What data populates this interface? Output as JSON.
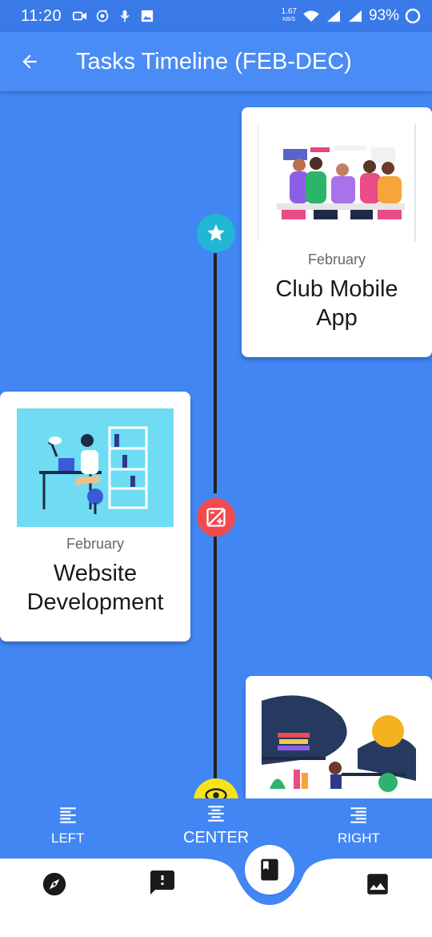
{
  "status_bar": {
    "time": "11:20",
    "net_speed_value": "1.67",
    "net_speed_unit": "KB/S",
    "battery": "93%",
    "icons": [
      "video-icon",
      "music-icon",
      "mic-icon",
      "image-icon",
      "wifi-icon",
      "signal-icon",
      "signal-icon",
      "battery-ring-icon"
    ]
  },
  "app_bar": {
    "title": "Tasks Timeline (FEB-DEC)",
    "back_icon": "arrow-back-icon"
  },
  "timeline": [
    {
      "month": "February",
      "title_lines": [
        "Club Mobile",
        "App"
      ],
      "icon": "star-icon",
      "icon_color": "#21b6d3",
      "side": "right",
      "illustration": "team-meeting"
    },
    {
      "month": "February",
      "title_lines": [
        "Website",
        "Development"
      ],
      "icon": "exposure-icon",
      "icon_color": "#ef4b4f",
      "side": "left",
      "illustration": "desk-worker"
    },
    {
      "month": "",
      "title_lines": [],
      "icon": "eye-icon",
      "icon_color": "#f8e21a",
      "side": "right",
      "illustration": "library"
    }
  ],
  "align_bar": {
    "left": "LEFT",
    "center": "CENTER",
    "right": "RIGHT"
  },
  "bottom_nav": {
    "items": [
      "explore-icon",
      "feedback-icon",
      "book-icon",
      "photo-icon"
    ],
    "active": "book-icon"
  },
  "colors": {
    "background": "#4286f4",
    "app_bar": "#4a8cf6",
    "line": "#222222",
    "star_node": "#21b6d3",
    "exposure_node": "#ef4b4f",
    "eye_node": "#f8e21a"
  }
}
